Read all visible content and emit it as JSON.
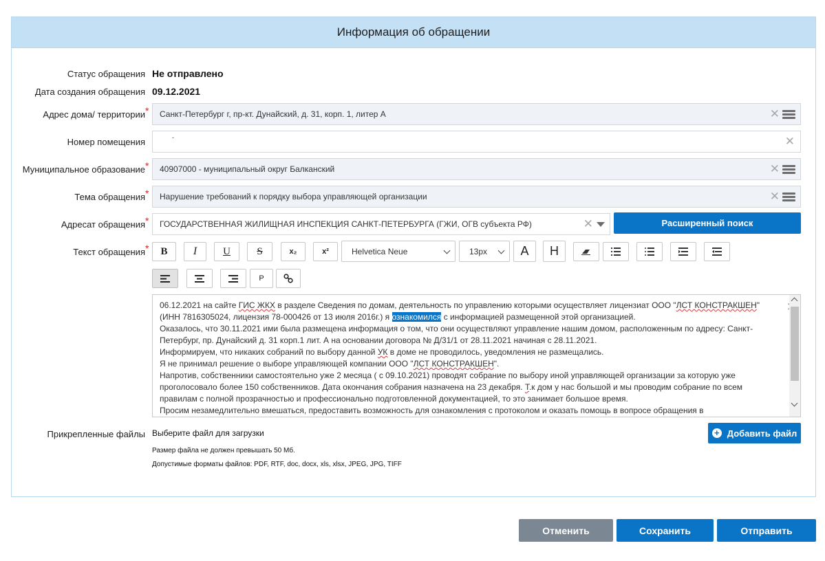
{
  "panel": {
    "title": "Информация об обращении"
  },
  "status": {
    "label": "Статус обращения",
    "value": "Не отправлено"
  },
  "created": {
    "label": "Дата создания обращения",
    "value": "09.12.2021"
  },
  "address": {
    "label": "Адрес дома/ территории",
    "value": "Санкт-Петербург г, пр-кт. Дунайский, д. 31, корп. 1, литер А"
  },
  "room": {
    "label": "Номер помещения",
    "value": "-"
  },
  "municipality": {
    "label": "Муниципальное образование",
    "value": "40907000 - муниципальный округ Балканский"
  },
  "topic": {
    "label": "Тема обращения",
    "value": "Нарушение требований к порядку выбора управляющей организации"
  },
  "recipient": {
    "label": "Адресат обращения",
    "value": "ГОСУДАРСТВЕННАЯ ЖИЛИЩНАЯ ИНСПЕКЦИЯ САНКТ-ПЕТЕРБУРГА (ГЖИ, ОГВ субъекта РФ)",
    "advanced_search": "Расширенный поиск"
  },
  "text": {
    "label": "Текст обращения",
    "toolbar": {
      "bold": "B",
      "italic": "I",
      "underline": "U",
      "strike": "S",
      "sub": "x₂",
      "sup": "x²",
      "font": "Helvetica Neue",
      "size": "13px",
      "font_color": "A",
      "highlight": "H",
      "paragraph": "P"
    },
    "lines": [
      [
        "06.12.2021 на сайте ",
        "ГИС ЖКХ",
        " в разделе Сведения по домам, деятельность по управлению которыми осуществляет лицензиат ООО \"",
        "ЛСТ КОНСТРАКШЕН",
        "\""
      ],
      [
        "(ИНН 7816305024, лицензия 78-000426 от 13 июля 2016г.) я ",
        "ознакомился",
        " с информацией размещенной этой организацией."
      ],
      [
        "Оказалось, что 30.11.2021 ими была размещена информация о том, что они осуществляют управление нашим домом, расположенным по адресу: Санкт-"
      ],
      [
        "Петербург, пр. Дунайский ",
        "д",
        ". 31 корп.1 лит. А на основании договора № ",
        "Д",
        "/31/1 от 28.11.2021 начиная с 28.11.2021."
      ],
      [
        "Информируем, что никаких собраний по выбору данной ",
        "УК",
        " в доме не проводилось, уведомления не размещались."
      ],
      [
        "Я не принимал решение о выборе управляющей компании ООО \"",
        "ЛСТ КОНСТРАКШЕН",
        "\"."
      ],
      [
        "Напротив, собственники самостоятельно уже 2 месяца ( с 09.10.2021) проводят собрание по выбору иной управляющей организации за которую уже"
      ],
      [
        "проголосовало более 150 собственников. Дата окончания собрания назначена на 23 декабря. ",
        "Т",
        ".к дом у нас большой и мы проводим собрание по всем"
      ],
      [
        "правилам с полной прозрачностью и профессионально подготовленной документацией, то это занимает большое время."
      ],
      [
        "Просим незамедлительно вмешаться, предоставить возможность для ознакомления с протоколом и оказать помощь в вопросе обращения в"
      ]
    ]
  },
  "files": {
    "label": "Прикрепленные файлы",
    "choose": "Выберите файл для загрузки",
    "add_button": "Добавить файл",
    "size_note": "Размер файла не должен превышать 50 Мб.",
    "formats_note": "Допустимые форматы файлов: PDF, RTF, doc, docx, xls, xlsx, JPEG, JPG, TIFF"
  },
  "actions": {
    "cancel": "Отменить",
    "save": "Сохранить",
    "send": "Отправить"
  },
  "colors": {
    "accent": "#0a74c7",
    "header_bg": "#c4e0f5",
    "cancel_bg": "#7b8793",
    "required": "#c5282a"
  }
}
